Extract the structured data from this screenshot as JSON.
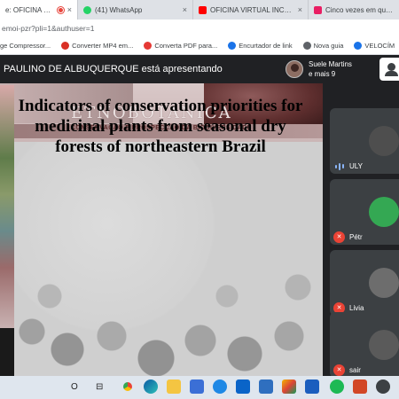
{
  "browser": {
    "tabs": [
      {
        "label": "e: OFICINA VIRTUAL",
        "active": true
      },
      {
        "label": "(41) WhatsApp",
        "active": false
      },
      {
        "label": "OFICINA VIRTUAL INCT 202",
        "active": false
      },
      {
        "label": "Cinco vezes em que Ru",
        "active": false
      }
    ],
    "close_glyph": "×",
    "address": "emoi-pzr?pli=1&authuser=1",
    "bookmarks": [
      {
        "label": "ge Compressor...",
        "icon": "compressor-icon",
        "color": "#cc3a2e"
      },
      {
        "label": "Converter MP4 em...",
        "icon": "converter-icon",
        "color": "#d93025"
      },
      {
        "label": "Converta PDF para...",
        "icon": "heart-icon",
        "color": "#e53935"
      },
      {
        "label": "Encurtador de link",
        "icon": "link-icon",
        "color": "#1a73e8"
      },
      {
        "label": "Nova guia",
        "icon": "globe-icon",
        "color": "#5f6368"
      },
      {
        "label": "VELOCÍM",
        "icon": "speed-icon",
        "color": "#1a73e8"
      }
    ]
  },
  "meet": {
    "presenter_text": "PAULINO DE ALBUQUERQUE está apresentando",
    "joiner_name": "Suele Martins",
    "joiner_more": "e mais 9"
  },
  "slide": {
    "logo_title": "ETNOBOTÂNICA",
    "logo_subtitle": "CONSERVAÇÃO E PROSPECÇÃO DA BIODIVERSIDADE",
    "title": "Indicators of conservation priorities for medicinal plants from seasonal dry forests of northeastern Brazil"
  },
  "participants": [
    {
      "name": "ULY",
      "muted": false,
      "avatar_color": "#4e4e4e"
    },
    {
      "name": "Pétr",
      "muted": true,
      "avatar_color": "#34a853"
    },
    {
      "name": "Livia",
      "muted": true,
      "avatar_color": "#6d6d6d"
    },
    {
      "name": "sair",
      "muted": true,
      "avatar_color": "#5a5a5a"
    }
  ],
  "taskbar": {
    "search_glyph": "O",
    "taskview_glyph": "⊟",
    "icons": [
      "chrome-icon",
      "edge-icon",
      "file-explorer-icon",
      "store-icon",
      "browser-icon",
      "mail-icon",
      "app-icon",
      "paint-icon",
      "word-icon",
      "spotify-icon",
      "powerpoint-icon",
      "settings-icon"
    ]
  }
}
